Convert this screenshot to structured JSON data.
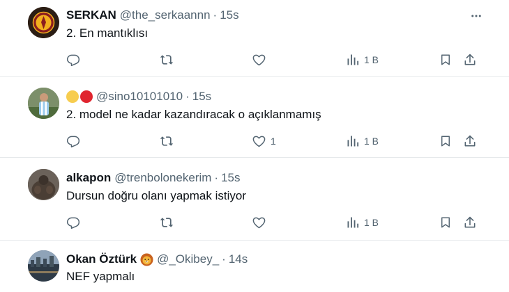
{
  "colors": {
    "text": "#0f1419",
    "secondary": "#536471",
    "divider": "#e6e9eb",
    "emoji_yellow": "#f7cd4f",
    "emoji_red": "#e0252f"
  },
  "tweets": [
    {
      "name": "SERKAN",
      "handle": "@the_serkaannn",
      "dot": "·",
      "time": "15s",
      "text": "2. En mantıklısı",
      "like_count": "",
      "views": "1 B"
    },
    {
      "name": "",
      "handle": "@sino10101010",
      "dot": "·",
      "time": "15s",
      "text": "2. model ne kadar kazandıracak o açıklanmamış",
      "like_count": "1",
      "views": "1 B"
    },
    {
      "name": "alkapon",
      "handle": "@trenbolonekerim",
      "dot": "·",
      "time": "15s",
      "text": "Dursun doğru olanı yapmak istiyor",
      "like_count": "",
      "views": "1 B"
    },
    {
      "name": "Okan Öztürk",
      "handle": "@_Okibey_",
      "dot": "·",
      "time": "14s",
      "text": "NEF yapmalı"
    }
  ],
  "icons": {
    "more": "more-horizontal-icon",
    "reply": "reply-icon",
    "retweet": "retweet-icon",
    "like": "heart-icon",
    "views": "views-chart-icon",
    "bookmark": "bookmark-icon",
    "share": "share-icon",
    "lion": "lion-emoji-icon"
  }
}
